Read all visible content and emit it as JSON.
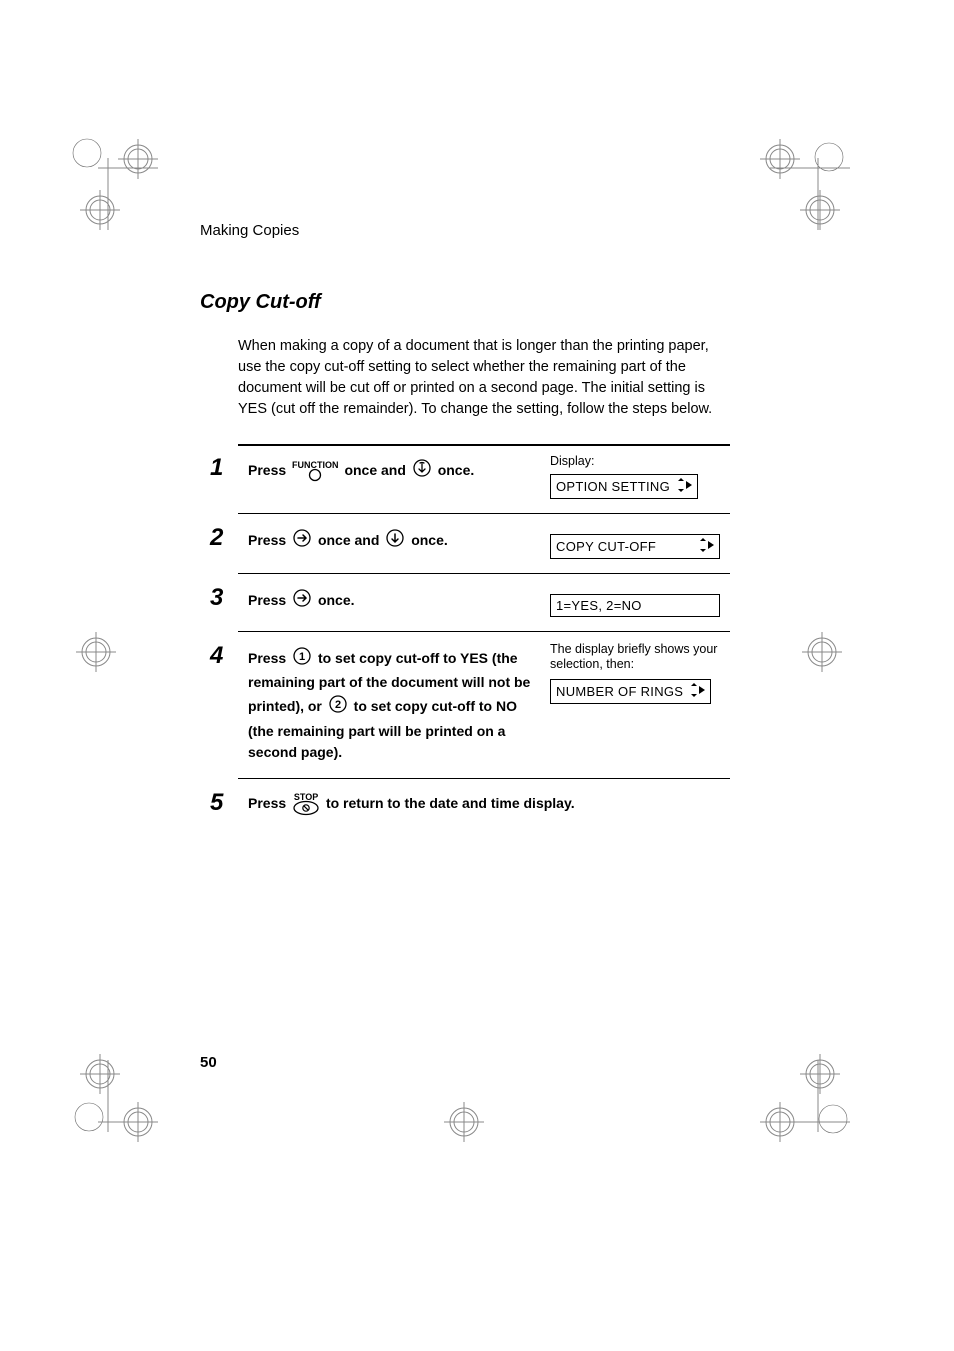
{
  "header": {
    "chapter": "Making Copies"
  },
  "section": {
    "title": "Copy Cut-off",
    "intro": "When making a copy of a document that is longer than the printing paper, use the copy cut-off setting to select whether the remaining part of the document will be cut off or printed on a second page. The initial setting is YES (cut off the remainder). To change the setting, follow the steps below."
  },
  "steps": {
    "s1": {
      "num": "1",
      "press": "Press",
      "func": "FUNCTION",
      "part_a": "once and",
      "part_b": "once.",
      "display_label": "Display:",
      "lcd": "OPTION SETTING"
    },
    "s2": {
      "num": "2",
      "press": "Press",
      "part_a": "once and",
      "part_b": "once.",
      "lcd": "COPY CUT-OFF"
    },
    "s3": {
      "num": "3",
      "press": "Press",
      "part_b": "once.",
      "lcd": "1=YES, 2=NO"
    },
    "s4": {
      "num": "4",
      "press": "Press",
      "line_a": "to set copy cut-off to YES (the remaining part of the document will not be printed), or",
      "line_b": "to set copy cut-off to NO (the remaining part will be printed on a second page).",
      "brief": "The display briefly shows your selection, then:",
      "lcd": "NUMBER OF RINGS"
    },
    "s5": {
      "num": "5",
      "press": "Press",
      "stop": "STOP",
      "tail": "to return to the date and time display."
    }
  },
  "page_number": "50"
}
